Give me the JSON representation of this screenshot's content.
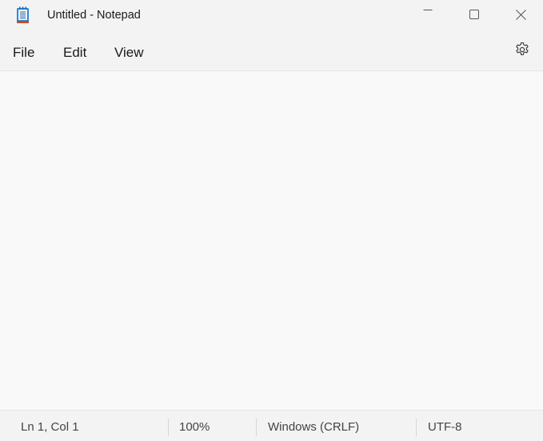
{
  "window": {
    "title": "Untitled - Notepad",
    "app_icon": "notepad-icon",
    "controls": {
      "minimize_icon": "minimize-icon",
      "maximize_icon": "maximize-icon",
      "close_icon": "close-icon"
    }
  },
  "menu": {
    "items": [
      {
        "label": "File"
      },
      {
        "label": "Edit"
      },
      {
        "label": "View"
      }
    ],
    "settings_icon": "gear-icon"
  },
  "editor": {
    "content": ""
  },
  "status": {
    "position": "Ln 1, Col 1",
    "zoom": "100%",
    "line_ending": "Windows (CRLF)",
    "encoding": "UTF-8"
  },
  "colors": {
    "chrome_bg": "#f3f3f3",
    "editor_bg": "#f9f9f9",
    "icon_accent": "#2b88d8",
    "icon_binding": "#c84b1b"
  }
}
